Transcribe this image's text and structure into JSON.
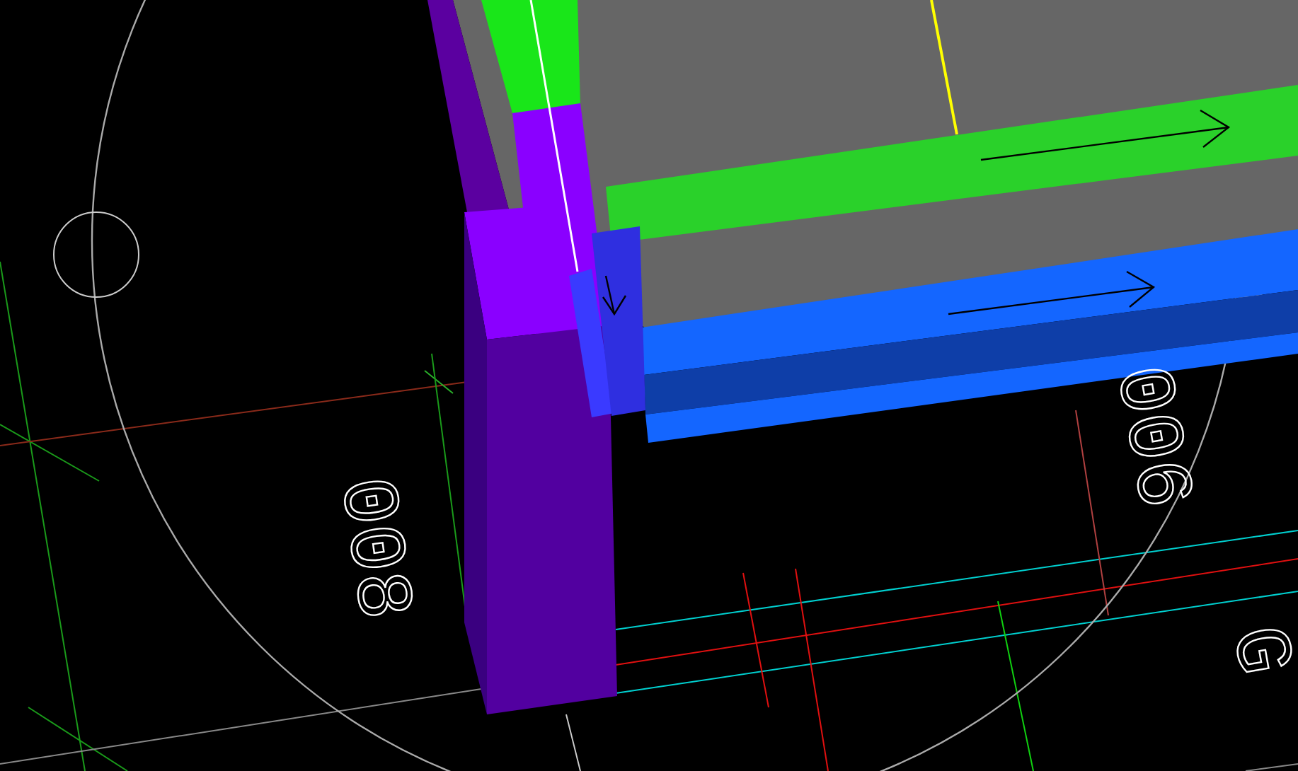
{
  "view": {
    "labels": [
      {
        "text": "008",
        "kind": "grid-tag"
      },
      {
        "text": "006",
        "kind": "grid-tag"
      },
      {
        "text": "G",
        "kind": "edge-tag"
      }
    ]
  }
}
